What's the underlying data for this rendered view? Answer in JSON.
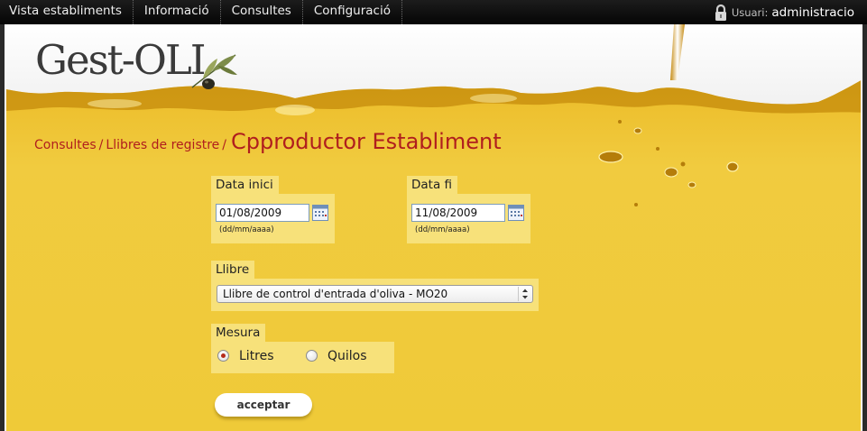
{
  "nav": {
    "items": [
      "Vista establiments",
      "Informació",
      "Consultes",
      "Configuració"
    ],
    "user_label": "Usuari:",
    "user_name": "administracio"
  },
  "logo": {
    "text": "Gest-OLI"
  },
  "breadcrumb": {
    "items": [
      "Consultes",
      "Llibres de registre"
    ],
    "separator": "/",
    "title": "Cpproductor Establiment"
  },
  "form": {
    "start_date": {
      "label": "Data inici",
      "value": "01/08/2009",
      "hint": "(dd/mm/aaaa)"
    },
    "end_date": {
      "label": "Data fi",
      "value": "11/08/2009",
      "hint": "(dd/mm/aaaa)"
    },
    "book": {
      "label": "Llibre",
      "selected": "Llibre de control d'entrada d'oliva - MO20"
    },
    "measure": {
      "label": "Mesura",
      "options": [
        {
          "label": "Litres",
          "checked": true
        },
        {
          "label": "Quilos",
          "checked": false
        }
      ]
    },
    "submit_label": "acceptar"
  },
  "colors": {
    "accent": "#b01e1e",
    "oil": "#efc93a",
    "field_bg": "#f7e17a",
    "topbar": "#0a0a0a"
  },
  "icons": [
    "lock-icon",
    "olive-icon",
    "calendar-icon",
    "select-arrows-icon"
  ]
}
